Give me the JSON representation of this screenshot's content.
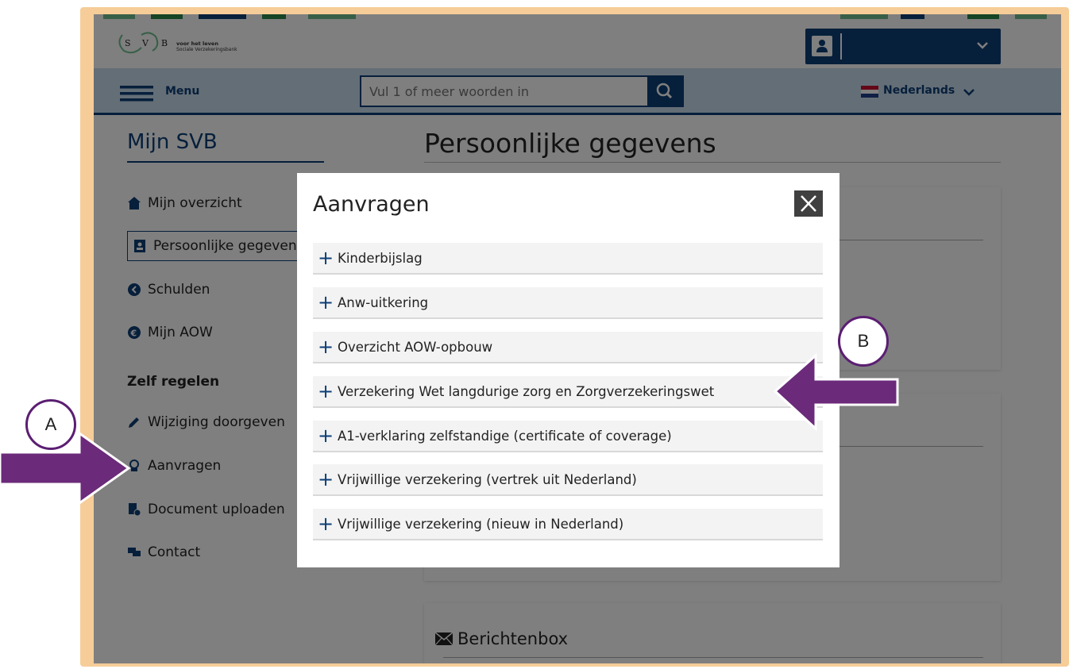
{
  "header": {
    "logo_text": "SVB",
    "logo_tagline": "voor het leven",
    "logo_name": "Sociale Verzekeringsbank"
  },
  "navbar": {
    "menu_label": "Menu",
    "search_placeholder": "Vul 1 of meer woorden in",
    "language": "Nederlands"
  },
  "sidebar": {
    "title_prefix": "Mijn",
    "title_brand": "SVB",
    "items": [
      {
        "label": "Mijn overzicht"
      },
      {
        "label": "Persoonlijke gegevens"
      },
      {
        "label": "Schulden"
      },
      {
        "label": "Mijn AOW"
      }
    ],
    "section_heading": "Zelf regelen",
    "self_items": [
      {
        "label": "Wijziging doorgeven"
      },
      {
        "label": "Aanvragen"
      },
      {
        "label": "Document uploaden"
      },
      {
        "label": "Contact"
      }
    ]
  },
  "main": {
    "title": "Persoonlijke gegevens",
    "berichtenbox": "Berichtenbox"
  },
  "modal": {
    "title": "Aanvragen",
    "items": [
      {
        "label": "Kinderbijslag"
      },
      {
        "label": "Anw-uitkering"
      },
      {
        "label": "Overzicht AOW-opbouw"
      },
      {
        "label": "Verzekering Wet langdurige zorg en Zorgverzekeringswet"
      },
      {
        "label": "A1-verklaring zelfstandige (certificate of coverage)"
      },
      {
        "label": "Vrijwillige verzekering (vertrek uit Nederland)"
      },
      {
        "label": "Vrijwillige verzekering (nieuw in Nederland)"
      }
    ]
  },
  "annotations": {
    "callout_a": "A",
    "callout_b": "B"
  },
  "colors": {
    "brand_blue": "#0d3e77",
    "frame": "#f6cd98",
    "arrow": "#6b2a7a"
  }
}
